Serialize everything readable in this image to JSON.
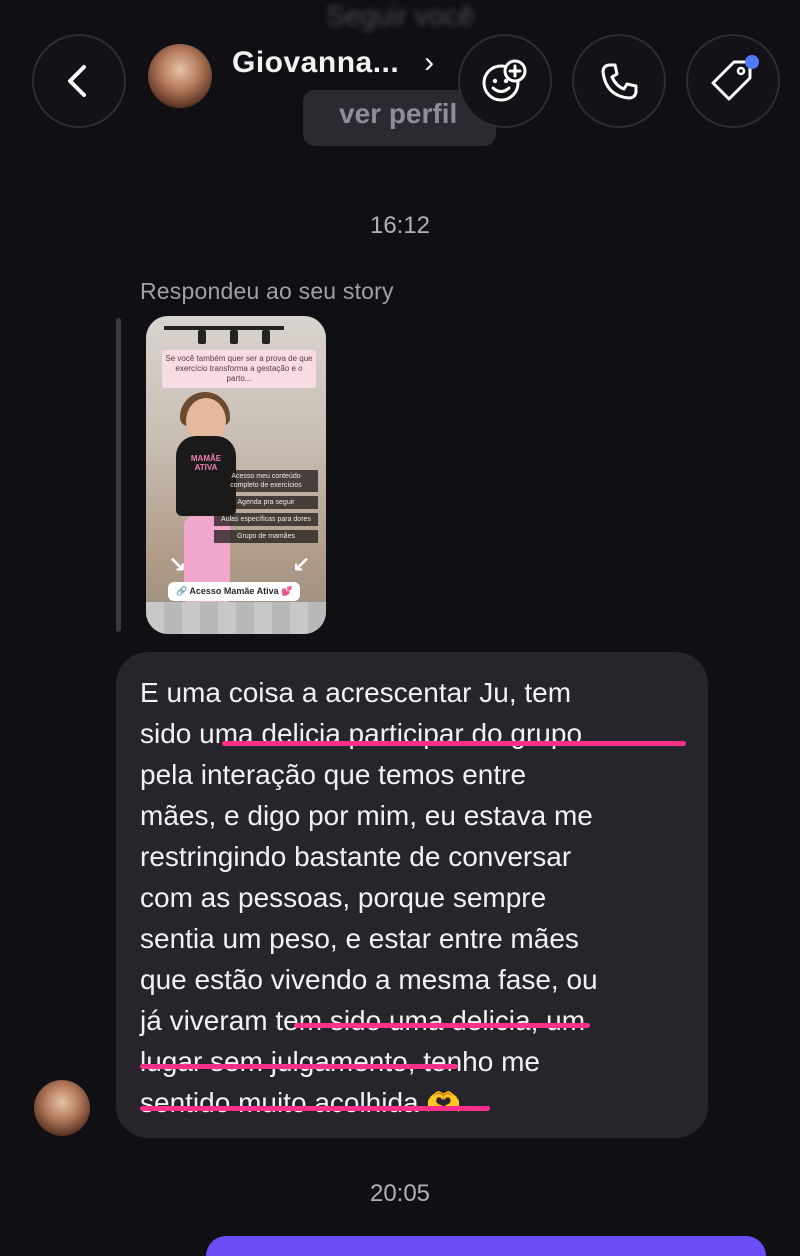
{
  "header": {
    "top_label": "Seguir você",
    "contact_name": "Giovanna...",
    "chevron": "›",
    "profile_pill": "ver perfil",
    "accent_dot": "#4f7bff"
  },
  "messages": {
    "timestamp_1": "16:12",
    "reply_label": "Respondeu ao seu story",
    "story": {
      "caption": "Se você também quer ser a prova de que exercício transforma a gestação e o parto...",
      "shirt_text": "MAMÃE ATIVA",
      "menu": [
        "Acesso meu conteúdo completo de exercícios",
        "Agenda pra seguir",
        "Aulas específicas para dores",
        "Grupo de mamães"
      ],
      "link": "🔗 Acesso Mamãe Ativa 💕"
    },
    "message_text": "E uma coisa a acrescentar Ju, tem\nsido uma delicia participar do grupo\npela interação que temos entre\nmães, e digo por mim, eu estava me\nrestringindo bastante de conversar\ncom as pessoas, porque sempre\nsentia um peso, e estar entre mães\nque estão vivendo a mesma fase, ou\njá viveram tem sido uma delicia, um\nlugar sem julgamento, tenho me\nsentido muito acolhida 🫶",
    "timestamp_2": "20:05"
  },
  "icons": {
    "back": "chevron-left-icon",
    "sticker": "sticker-add-icon",
    "call": "phone-icon",
    "tag": "tag-icon"
  },
  "colors": {
    "background": "#0f0f14",
    "bubble": "#25252b",
    "underline": "#ff2f8c",
    "next_bubble": "#6c4cf5"
  }
}
